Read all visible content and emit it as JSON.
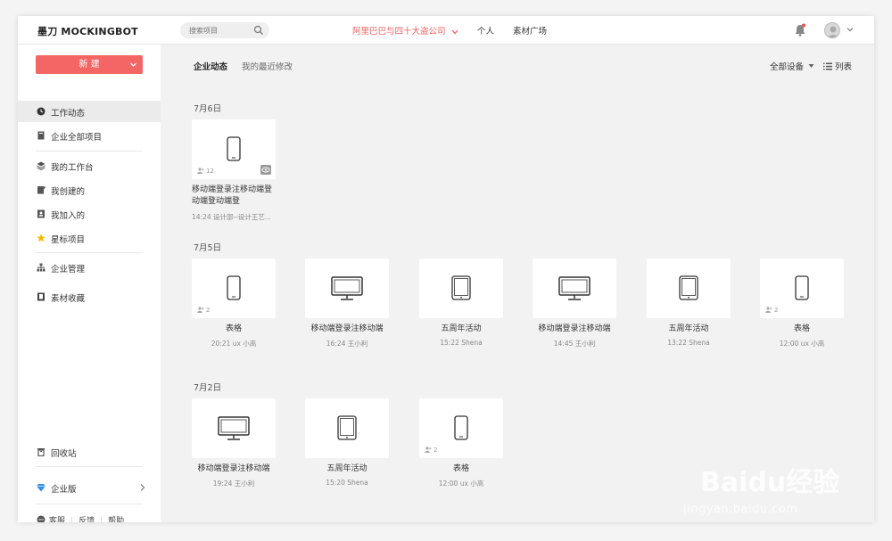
{
  "app": {
    "logo": "墨刀 MOCKINGBOT",
    "search_placeholder": "搜索项目",
    "company": "阿里巴巴与四十大盗公司",
    "nav": [
      "个人",
      "素材广场"
    ]
  },
  "sidebar": {
    "new_button": "新 建",
    "items": [
      {
        "label": "工作动态",
        "icon": "clock-icon"
      },
      {
        "label": "企业全部项目",
        "icon": "book-icon"
      },
      {
        "label": "我的工作台",
        "icon": "layers-icon"
      },
      {
        "label": "我创建的",
        "icon": "edit-doc-icon"
      },
      {
        "label": "我加入的",
        "icon": "user-doc-icon"
      },
      {
        "label": "星标项目",
        "icon": "star-icon"
      },
      {
        "label": "企业管理",
        "icon": "org-icon"
      },
      {
        "label": "素材收藏",
        "icon": "bookmark-icon"
      },
      {
        "label": "回收站",
        "icon": "trash-icon"
      },
      {
        "label": "企业版",
        "icon": "diamond-icon"
      }
    ],
    "footer": [
      "客服",
      "反馈",
      "帮助"
    ]
  },
  "main": {
    "tabs": [
      "企业动态",
      "我的最近修改"
    ],
    "device_filter": "全部设备",
    "view_mode": "列表",
    "groups": [
      {
        "date": "7月6日",
        "cards": [
          {
            "device": "phone",
            "title": "移动端登录注移动端登动端登动端登",
            "meta": "14:24  设计部--设计王艺...",
            "members": "12",
            "eye": true
          }
        ]
      },
      {
        "date": "7月5日",
        "cards": [
          {
            "device": "phone",
            "title": "表格",
            "meta": "20:21  ux 小高",
            "members": "2",
            "eye": false
          },
          {
            "device": "desktop",
            "title": "移动端登录注移动端",
            "meta": "16:24  王小利",
            "members": "",
            "eye": false
          },
          {
            "device": "tablet",
            "title": "五周年活动",
            "meta": "15:22  Shena",
            "members": "",
            "eye": false
          },
          {
            "device": "desktop",
            "title": "移动端登录注移动端",
            "meta": "14:45  王小利",
            "members": "",
            "eye": false
          },
          {
            "device": "tablet",
            "title": "五周年活动",
            "meta": "13:22  Shena",
            "members": "",
            "eye": false
          },
          {
            "device": "phone",
            "title": "表格",
            "meta": "12:00  ux 小高",
            "members": "2",
            "eye": false
          }
        ]
      },
      {
        "date": "7月2日",
        "cards": [
          {
            "device": "desktop",
            "title": "移动端登录注移动端",
            "meta": "19:24  王小利",
            "members": "",
            "eye": false
          },
          {
            "device": "tablet",
            "title": "五周年活动",
            "meta": "15:20  Shena",
            "members": "",
            "eye": false
          },
          {
            "device": "phone",
            "title": "表格",
            "meta": "12:00  ux 小高",
            "members": "2",
            "eye": false
          }
        ]
      }
    ]
  },
  "watermark": {
    "main": "Baidu经验",
    "sub": "jingyan.baidu.com"
  },
  "colors": {
    "accent": "#f46565",
    "company": "#f06060"
  }
}
